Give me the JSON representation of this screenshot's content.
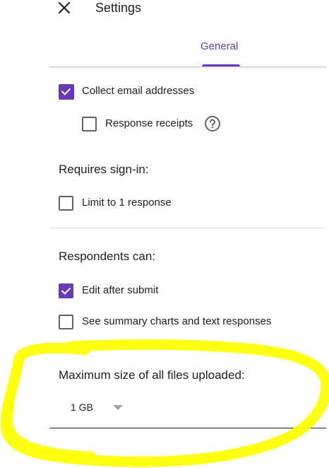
{
  "header": {
    "title": "Settings",
    "close_icon": "close-icon",
    "tabs": [
      {
        "label": "General",
        "active": true
      }
    ]
  },
  "accent_color": "#673ab7",
  "highlight_color": "#ffff00",
  "responses": {
    "collect_email": {
      "label": "Collect email addresses",
      "checked": true
    },
    "response_receipts": {
      "label": "Response receipts",
      "checked": false,
      "help_icon": "help-circle-icon"
    }
  },
  "sign_in": {
    "title": "Requires sign-in:",
    "limit_one": {
      "label": "Limit to 1 response",
      "checked": false
    }
  },
  "respondents": {
    "title": "Respondents can:",
    "edit_after_submit": {
      "label": "Edit after submit",
      "checked": true
    },
    "see_summary": {
      "label": "See summary charts and text responses",
      "checked": false
    }
  },
  "uploads": {
    "title": "Maximum size of all files uploaded:",
    "max_size": "1 GB"
  }
}
